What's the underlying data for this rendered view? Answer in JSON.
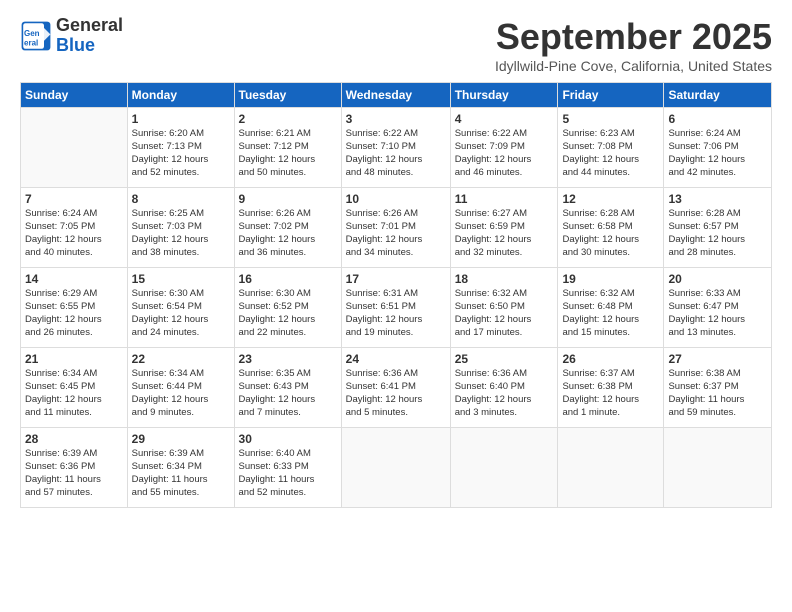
{
  "header": {
    "logo_line1": "General",
    "logo_line2": "Blue",
    "month": "September 2025",
    "location": "Idyllwild-Pine Cove, California, United States"
  },
  "weekdays": [
    "Sunday",
    "Monday",
    "Tuesday",
    "Wednesday",
    "Thursday",
    "Friday",
    "Saturday"
  ],
  "weeks": [
    [
      {
        "day": "",
        "info": ""
      },
      {
        "day": "1",
        "info": "Sunrise: 6:20 AM\nSunset: 7:13 PM\nDaylight: 12 hours\nand 52 minutes."
      },
      {
        "day": "2",
        "info": "Sunrise: 6:21 AM\nSunset: 7:12 PM\nDaylight: 12 hours\nand 50 minutes."
      },
      {
        "day": "3",
        "info": "Sunrise: 6:22 AM\nSunset: 7:10 PM\nDaylight: 12 hours\nand 48 minutes."
      },
      {
        "day": "4",
        "info": "Sunrise: 6:22 AM\nSunset: 7:09 PM\nDaylight: 12 hours\nand 46 minutes."
      },
      {
        "day": "5",
        "info": "Sunrise: 6:23 AM\nSunset: 7:08 PM\nDaylight: 12 hours\nand 44 minutes."
      },
      {
        "day": "6",
        "info": "Sunrise: 6:24 AM\nSunset: 7:06 PM\nDaylight: 12 hours\nand 42 minutes."
      }
    ],
    [
      {
        "day": "7",
        "info": "Sunrise: 6:24 AM\nSunset: 7:05 PM\nDaylight: 12 hours\nand 40 minutes."
      },
      {
        "day": "8",
        "info": "Sunrise: 6:25 AM\nSunset: 7:03 PM\nDaylight: 12 hours\nand 38 minutes."
      },
      {
        "day": "9",
        "info": "Sunrise: 6:26 AM\nSunset: 7:02 PM\nDaylight: 12 hours\nand 36 minutes."
      },
      {
        "day": "10",
        "info": "Sunrise: 6:26 AM\nSunset: 7:01 PM\nDaylight: 12 hours\nand 34 minutes."
      },
      {
        "day": "11",
        "info": "Sunrise: 6:27 AM\nSunset: 6:59 PM\nDaylight: 12 hours\nand 32 minutes."
      },
      {
        "day": "12",
        "info": "Sunrise: 6:28 AM\nSunset: 6:58 PM\nDaylight: 12 hours\nand 30 minutes."
      },
      {
        "day": "13",
        "info": "Sunrise: 6:28 AM\nSunset: 6:57 PM\nDaylight: 12 hours\nand 28 minutes."
      }
    ],
    [
      {
        "day": "14",
        "info": "Sunrise: 6:29 AM\nSunset: 6:55 PM\nDaylight: 12 hours\nand 26 minutes."
      },
      {
        "day": "15",
        "info": "Sunrise: 6:30 AM\nSunset: 6:54 PM\nDaylight: 12 hours\nand 24 minutes."
      },
      {
        "day": "16",
        "info": "Sunrise: 6:30 AM\nSunset: 6:52 PM\nDaylight: 12 hours\nand 22 minutes."
      },
      {
        "day": "17",
        "info": "Sunrise: 6:31 AM\nSunset: 6:51 PM\nDaylight: 12 hours\nand 19 minutes."
      },
      {
        "day": "18",
        "info": "Sunrise: 6:32 AM\nSunset: 6:50 PM\nDaylight: 12 hours\nand 17 minutes."
      },
      {
        "day": "19",
        "info": "Sunrise: 6:32 AM\nSunset: 6:48 PM\nDaylight: 12 hours\nand 15 minutes."
      },
      {
        "day": "20",
        "info": "Sunrise: 6:33 AM\nSunset: 6:47 PM\nDaylight: 12 hours\nand 13 minutes."
      }
    ],
    [
      {
        "day": "21",
        "info": "Sunrise: 6:34 AM\nSunset: 6:45 PM\nDaylight: 12 hours\nand 11 minutes."
      },
      {
        "day": "22",
        "info": "Sunrise: 6:34 AM\nSunset: 6:44 PM\nDaylight: 12 hours\nand 9 minutes."
      },
      {
        "day": "23",
        "info": "Sunrise: 6:35 AM\nSunset: 6:43 PM\nDaylight: 12 hours\nand 7 minutes."
      },
      {
        "day": "24",
        "info": "Sunrise: 6:36 AM\nSunset: 6:41 PM\nDaylight: 12 hours\nand 5 minutes."
      },
      {
        "day": "25",
        "info": "Sunrise: 6:36 AM\nSunset: 6:40 PM\nDaylight: 12 hours\nand 3 minutes."
      },
      {
        "day": "26",
        "info": "Sunrise: 6:37 AM\nSunset: 6:38 PM\nDaylight: 12 hours\nand 1 minute."
      },
      {
        "day": "27",
        "info": "Sunrise: 6:38 AM\nSunset: 6:37 PM\nDaylight: 11 hours\nand 59 minutes."
      }
    ],
    [
      {
        "day": "28",
        "info": "Sunrise: 6:39 AM\nSunset: 6:36 PM\nDaylight: 11 hours\nand 57 minutes."
      },
      {
        "day": "29",
        "info": "Sunrise: 6:39 AM\nSunset: 6:34 PM\nDaylight: 11 hours\nand 55 minutes."
      },
      {
        "day": "30",
        "info": "Sunrise: 6:40 AM\nSunset: 6:33 PM\nDaylight: 11 hours\nand 52 minutes."
      },
      {
        "day": "",
        "info": ""
      },
      {
        "day": "",
        "info": ""
      },
      {
        "day": "",
        "info": ""
      },
      {
        "day": "",
        "info": ""
      }
    ]
  ]
}
